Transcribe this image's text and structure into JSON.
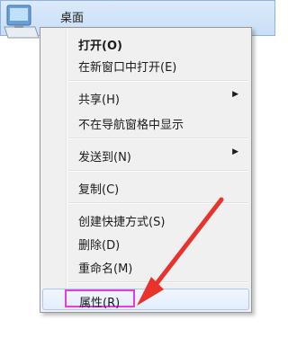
{
  "desktop": {
    "label": "桌面",
    "icon": "desktop-folder-icon"
  },
  "context_menu": {
    "items": [
      {
        "label": "打开(O)",
        "bold": true
      },
      {
        "label": "在新窗口中打开(E)"
      },
      {
        "label": "共享(H)",
        "submenu": true
      },
      {
        "label": "不在导航窗格中显示"
      },
      {
        "label": "发送到(N)",
        "submenu": true
      },
      {
        "label": "复制(C)"
      },
      {
        "label": "创建快捷方式(S)"
      },
      {
        "label": "删除(D)"
      },
      {
        "label": "重命名(M)"
      },
      {
        "label": "属性(R)",
        "highlighted": true
      }
    ],
    "submenu_glyph": "▶"
  },
  "annotation": {
    "highlight_color": "#e63ce2",
    "arrow_color": "#e8322b"
  }
}
